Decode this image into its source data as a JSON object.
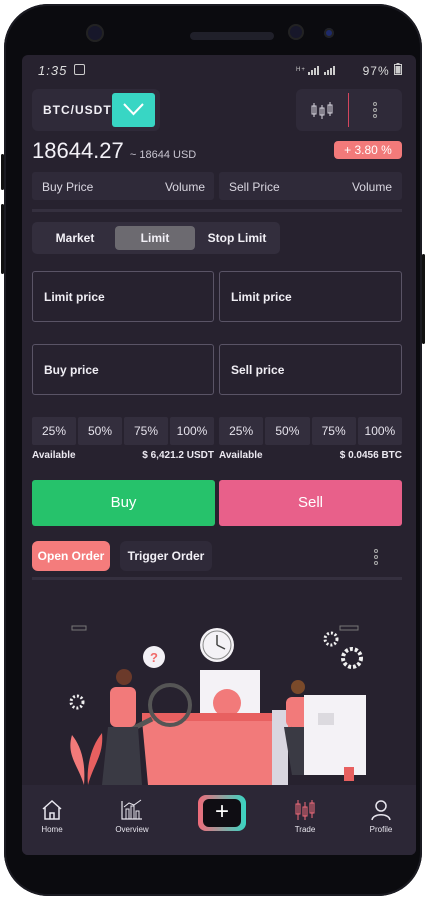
{
  "status": {
    "time": "1:35",
    "right_text": "97%"
  },
  "pair": {
    "label": "BTC/USDT"
  },
  "price": {
    "main": "18644.27",
    "approx": "~ 18644 USD",
    "change": "+ 3.80 %"
  },
  "order_book": {
    "buy_price": "Buy Price",
    "volume_left": "Volume",
    "sell_price": "Sell Price",
    "volume_right": "Volume"
  },
  "order_type_tabs": [
    {
      "label": "Market"
    },
    {
      "label": "Limit",
      "active": true
    },
    {
      "label": "Stop Limit"
    }
  ],
  "fields": {
    "limit_price_left": "Limit price",
    "limit_price_right": "Limit price",
    "buy_price": "Buy price",
    "sell_price": "Sell price"
  },
  "percent_left": [
    "25%",
    "50%",
    "75%",
    "100%"
  ],
  "percent_right": [
    "25%",
    "50%",
    "75%",
    "100%"
  ],
  "available": {
    "label_left": "Available",
    "value_left": "$ 6,421.2 USDT",
    "label_right": "Available",
    "value_right": "$ 0.0456 BTC"
  },
  "actions": {
    "buy": "Buy",
    "sell": "Sell"
  },
  "order_tabs": {
    "open": "Open Order",
    "trigger": "Trigger Order"
  },
  "nav": [
    {
      "label": "Home",
      "icon": "home-icon"
    },
    {
      "label": "Overview",
      "icon": "chart-icon"
    },
    {
      "label": "Trade",
      "icon": "candles-icon"
    },
    {
      "label": "Profile",
      "icon": "user-icon"
    }
  ],
  "colors": {
    "background": "#27222f",
    "accent_teal": "#38d6c4",
    "buy_green": "#26c26b",
    "sell_pink": "#e8608a",
    "badge_red": "#f27a7a"
  }
}
